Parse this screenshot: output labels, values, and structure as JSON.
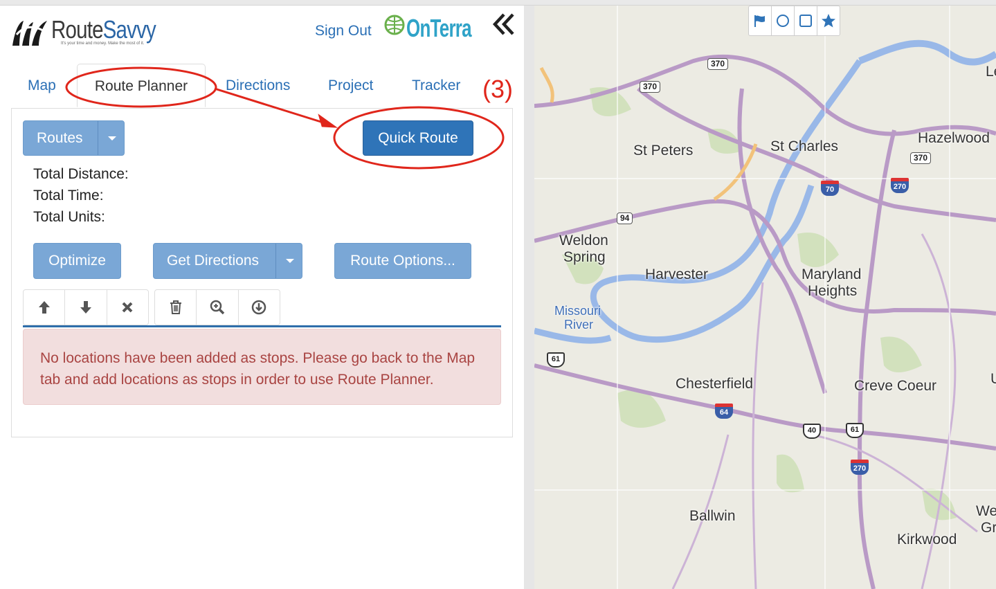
{
  "header": {
    "logo_route": "Route",
    "logo_savvy": "Savvy",
    "logo_tagline": "It's your time and money. Make the most of it.",
    "sign_out": "Sign Out",
    "onterra_logo": "OnTerra",
    "collapse_icon": "double-chevron-left-icon"
  },
  "tabs": [
    {
      "label": "Map"
    },
    {
      "label": "Route Planner"
    },
    {
      "label": "Directions"
    },
    {
      "label": "Project"
    },
    {
      "label": "Tracker"
    }
  ],
  "annotation": {
    "step": "(3)",
    "color": "#e0261b"
  },
  "planner": {
    "routes_button": "Routes",
    "quick_route_button": "Quick Route",
    "total_distance_label": "Total Distance:",
    "total_time_label": "Total Time:",
    "total_units_label": "Total Units:",
    "optimize_button": "Optimize",
    "get_directions_button": "Get Directions",
    "route_options_button": "Route Options...",
    "toolbar_icons": [
      "arrow-up-icon",
      "arrow-down-icon",
      "close-icon",
      "trash-icon",
      "zoom-in-icon",
      "download-circle-icon"
    ],
    "alert_text": "No locations have been added as stops. Please go back to the Map tab and add locations as stops in order to use Route Planner."
  },
  "map": {
    "draw_tools": [
      "flag-icon",
      "circle-icon",
      "square-icon",
      "star-icon"
    ],
    "places": [
      "St Peters",
      "St Charles",
      "Hazelwood",
      "Weldon",
      "Spring",
      "Harvester",
      "Maryland",
      "Heights",
      "Missouri",
      "River",
      "Chesterfield",
      "Creve Coeur",
      "Ballwin",
      "Kirkwood",
      "Le",
      "U",
      "We",
      "Gr"
    ],
    "shields": [
      "370",
      "370",
      "370",
      "94",
      "61",
      "70",
      "270",
      "64",
      "40",
      "61",
      "270"
    ]
  },
  "colors": {
    "primary": "#2f74b8",
    "light_button": "#7aa7d6",
    "link": "#2a6fb5",
    "alert_bg": "#f2dede",
    "alert_text": "#a94442"
  }
}
